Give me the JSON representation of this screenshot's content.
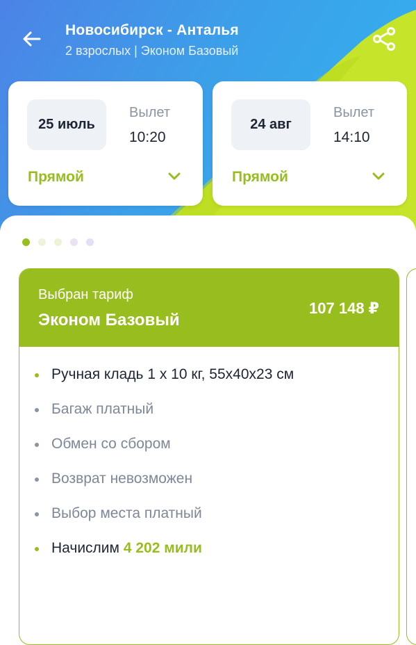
{
  "header": {
    "route": "Новосибирск - Анталья",
    "details": "2 взрослых | Эконом Базовый",
    "back_icon": "arrow-left-icon",
    "share_icon": "share-icon"
  },
  "segments": [
    {
      "date": "25 июль",
      "dep_label": "Вылет",
      "dep_time": "10:20",
      "type": "Прямой"
    },
    {
      "date": "24 авг",
      "dep_label": "Вылет",
      "dep_time": "14:10",
      "type": "Прямой"
    }
  ],
  "pager": {
    "count": 5,
    "active": 0
  },
  "tariff": {
    "selected_label": "Выбран тариф",
    "name": "Эконом Базовый",
    "price": "107 148 ₽",
    "features": [
      {
        "text": "Ручная кладь 1  х 10 кг, 55х40х23 см",
        "included": true
      },
      {
        "text": "Багаж платный",
        "included": false
      },
      {
        "text": "Обмен со сбором",
        "included": false
      },
      {
        "text": "Возврат невозможен",
        "included": false
      },
      {
        "text": "Выбор места платный",
        "included": false
      }
    ],
    "miles_prefix": "Начислим",
    "miles_value": "4 202 мили"
  },
  "colors": {
    "accent": "#97bd1f",
    "header_gradient_start": "#4c83e6",
    "header_gradient_end": "#31b4ee",
    "wing": "#c6e52a"
  }
}
